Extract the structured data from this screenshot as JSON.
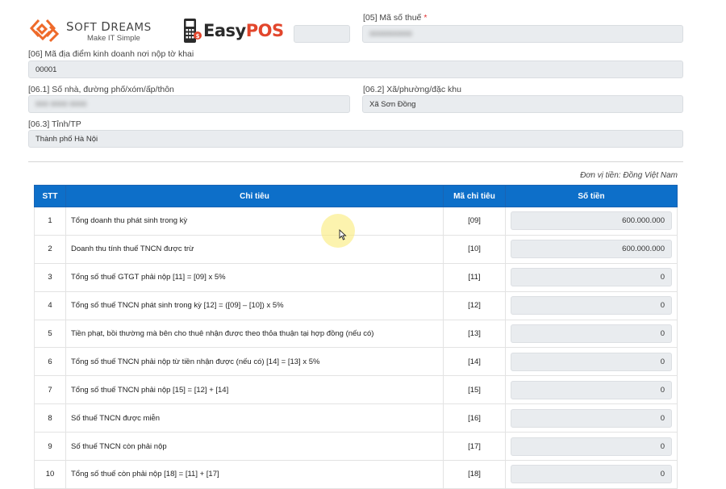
{
  "branding": {
    "softdreams_name_first_letter": "S",
    "softdreams_name_rest1": "OFT ",
    "softdreams_name_second_letter": "D",
    "softdreams_name_rest2": "REAMS",
    "softdreams_tagline": "Make IT Simple",
    "easypos_prefix": "Easy",
    "easypos_suffix": "POS",
    "colors": {
      "softdreams_orange": "#ee6a2a",
      "easypos_red": "#e2462c",
      "header_blue": "#0d6fc9"
    }
  },
  "form": {
    "tax_code_label": "[05] Mã số thuế",
    "tax_code_required": "*",
    "tax_code_value": "0000000000",
    "left_top_value": "",
    "location_code_label": "[06] Mã địa điểm kinh doanh nơi nộp tờ khai",
    "location_code_value": "00001",
    "address_label": "[06.1] Số nhà, đường phố/xóm/ấp/thôn",
    "address_value": "000 0000 0000",
    "ward_label": "[06.2] Xã/phường/đặc khu",
    "ward_value": "Xã Sơn Đồng",
    "province_label": "[06.3] Tỉnh/TP",
    "province_value": "Thành phố Hà Nội"
  },
  "table": {
    "currency_note": "Đơn vị tiền: Đồng Việt Nam",
    "headers": {
      "stt": "STT",
      "indicator": "Chỉ tiêu",
      "code": "Mã chỉ tiêu",
      "amount": "Số tiền"
    },
    "rows": [
      {
        "stt": "1",
        "indicator": "Tổng doanh thu phát sinh trong kỳ",
        "code": "[09]",
        "amount": "600.000.000"
      },
      {
        "stt": "2",
        "indicator": "Doanh thu tính thuế TNCN được trừ",
        "code": "[10]",
        "amount": "600.000.000"
      },
      {
        "stt": "3",
        "indicator": "Tổng số thuế GTGT phải nộp [11] = [09] x 5%",
        "code": "[11]",
        "amount": "0"
      },
      {
        "stt": "4",
        "indicator": "Tổng số thuế TNCN phát sinh trong kỳ [12] = ([09] – [10]) x 5%",
        "code": "[12]",
        "amount": "0"
      },
      {
        "stt": "5",
        "indicator": "Tiền phạt, bồi thường mà bên cho thuê nhận được theo thỏa thuận tại hợp đồng (nếu có)",
        "code": "[13]",
        "amount": "0"
      },
      {
        "stt": "6",
        "indicator": "Tổng số thuế TNCN phải nộp từ tiền nhận được (nếu có) [14] = [13] x 5%",
        "code": "[14]",
        "amount": "0"
      },
      {
        "stt": "7",
        "indicator": "Tổng số thuế TNCN phải nộp [15] = [12] + [14]",
        "code": "[15]",
        "amount": "0"
      },
      {
        "stt": "8",
        "indicator": "Số thuế TNCN được miễn",
        "code": "[16]",
        "amount": "0"
      },
      {
        "stt": "9",
        "indicator": "Số thuế TNCN còn phải nộp",
        "code": "[17]",
        "amount": "0"
      },
      {
        "stt": "10",
        "indicator": "Tổng số thuế còn phải nộp [18] = [11] + [17]",
        "code": "[18]",
        "amount": "0"
      }
    ]
  }
}
